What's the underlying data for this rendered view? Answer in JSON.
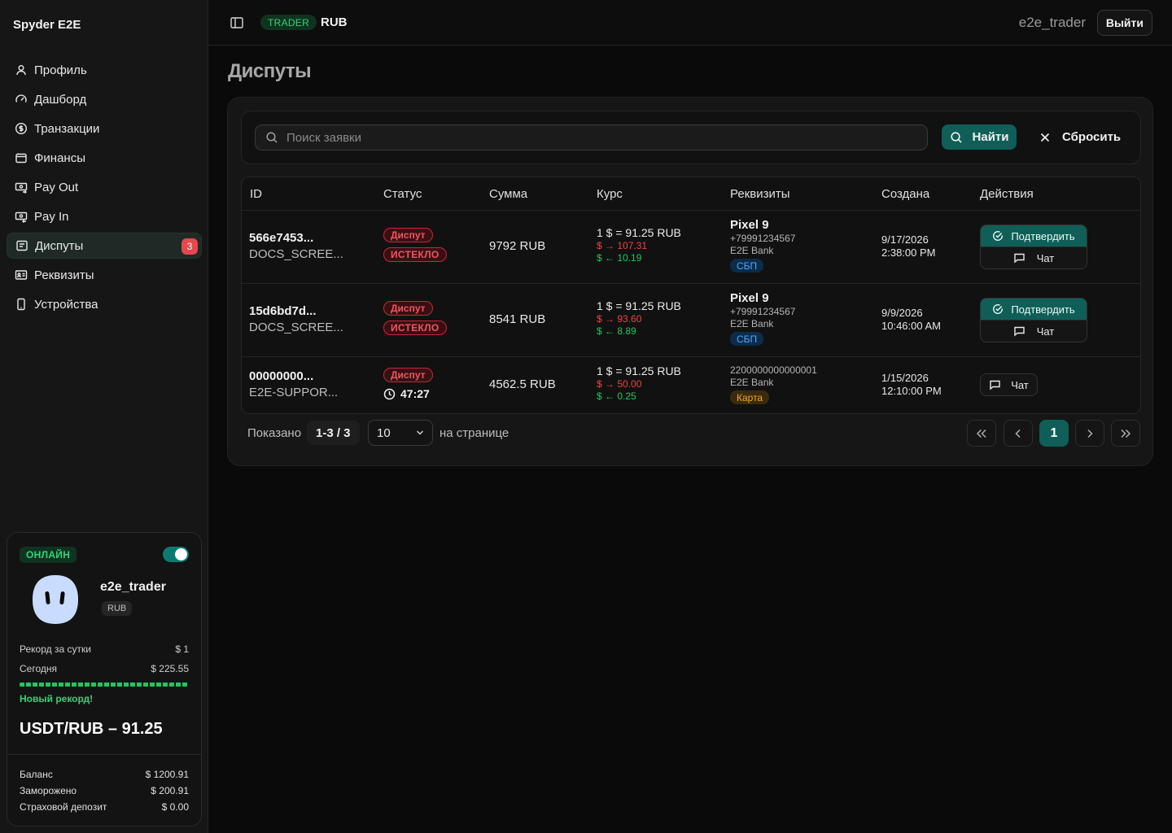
{
  "brand": "Spyder E2E",
  "sidebar": {
    "items": [
      {
        "label": "Профиль",
        "icon": "user-icon"
      },
      {
        "label": "Дашборд",
        "icon": "gauge-icon"
      },
      {
        "label": "Транзакции",
        "icon": "dollar-circle-icon"
      },
      {
        "label": "Финансы",
        "icon": "wallet-icon"
      },
      {
        "label": "Pay Out",
        "icon": "banknote-out-icon"
      },
      {
        "label": "Pay In",
        "icon": "banknote-in-icon"
      },
      {
        "label": "Диспуты",
        "icon": "dispute-icon",
        "badge": "3",
        "active": true
      },
      {
        "label": "Реквизиты",
        "icon": "id-card-icon"
      },
      {
        "label": "Устройства",
        "icon": "smartphone-icon"
      }
    ]
  },
  "profile_card": {
    "status": "ОНЛАЙН",
    "username": "e2e_trader",
    "currency": "RUB",
    "record_label": "Рекорд за сутки",
    "record_value": "$ 1",
    "today_label": "Сегодня",
    "today_value": "$ 225.55",
    "new_record": "Новый рекорд!",
    "pair": "USDT/RUB – 91.25",
    "balance_label": "Баланс",
    "balance_value": "$ 1200.91",
    "frozen_label": "Заморожено",
    "frozen_value": "$ 200.91",
    "deposit_label": "Страховой депозит",
    "deposit_value": "$ 0.00"
  },
  "header": {
    "role": "TRADER",
    "currency": "RUB",
    "user": "e2e_trader",
    "logout": "Выйти"
  },
  "page": {
    "title": "Диспуты",
    "search_placeholder": "Поиск заявки",
    "find": "Найти",
    "reset": "Сбросить"
  },
  "table": {
    "columns": [
      "ID",
      "Статус",
      "Сумма",
      "Курс",
      "Реквизиты",
      "Создана",
      "Действия"
    ],
    "rows": [
      {
        "id": "566e7453...",
        "sub": "DOCS_SCREE...",
        "status1": "Диспут",
        "status2": "ИСТЕКЛО",
        "amount": "9792 RUB",
        "rate": "1 $ = 91.25 RUB",
        "out": "$ → 107.31",
        "in": "$ ← 10.19",
        "req_title": "Pixel 9",
        "req_phone": "+79991234567",
        "req_bank": "E2E Bank",
        "req_tag": "СБП",
        "date": "9/17/2026",
        "time": "2:38:00 PM",
        "confirm": "Подтвердить",
        "chat": "Чат"
      },
      {
        "id": "15d6bd7d...",
        "sub": "DOCS_SCREE...",
        "status1": "Диспут",
        "status2": "ИСТЕКЛО",
        "amount": "8541 RUB",
        "rate": "1 $ = 91.25 RUB",
        "out": "$ → 93.60",
        "in": "$ ← 8.89",
        "req_title": "Pixel 9",
        "req_phone": "+79991234567",
        "req_bank": "E2E Bank",
        "req_tag": "СБП",
        "date": "9/9/2026",
        "time": "10:46:00 AM",
        "confirm": "Подтвердить",
        "chat": "Чат"
      },
      {
        "id": "00000000...",
        "sub": "E2E-SUPPOR...",
        "status1": "Диспут",
        "timer": "47:27",
        "amount": "4562.5 RUB",
        "rate": "1 $ = 91.25 RUB",
        "out": "$ → 50.00",
        "in": "$ ← 0.25",
        "req_card": "2200000000000001",
        "req_bank": "E2E Bank",
        "req_tag": "Карта",
        "date": "1/15/2026",
        "time": "12:10:00 PM",
        "chat": "Чат"
      }
    ]
  },
  "pagination": {
    "shown_label": "Показано",
    "shown_value": "1-3 / 3",
    "per_page": "10",
    "per_page_label": "на странице",
    "current_page": "1"
  }
}
